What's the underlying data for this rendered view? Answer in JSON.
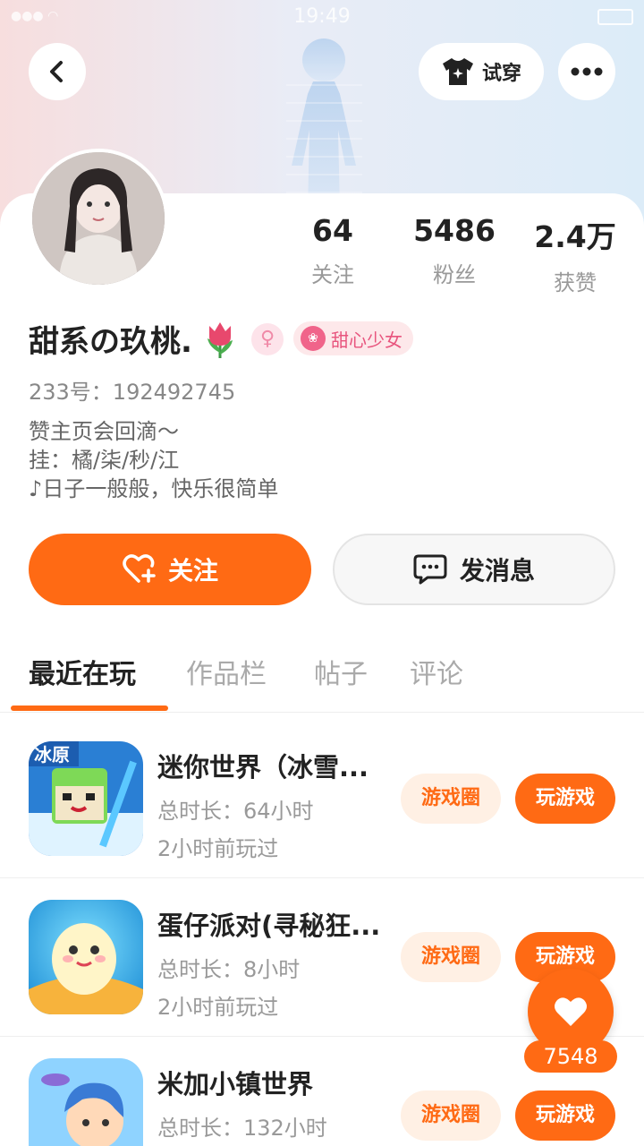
{
  "status_bar": {
    "time": "19:49"
  },
  "header": {
    "try_on_label": "试穿",
    "try_on_icon": "tshirt-icon",
    "more_icon": "more-dots-icon",
    "back_icon": "chevron-left-icon"
  },
  "profile": {
    "name": "甜系の玖桃.",
    "gender_symbol": "♀",
    "badge_label": "甜心少女",
    "uid": "233号：192492745",
    "bio": [
      "赞主页会回滴～",
      "挂：橘/柒/秒/江",
      "♪日子一般般，快乐很简单"
    ]
  },
  "stats": [
    {
      "value": "64",
      "label": "关注"
    },
    {
      "value": "5486",
      "label": "粉丝"
    },
    {
      "value": "2.4万",
      "label": "获赞"
    }
  ],
  "actions": {
    "follow_label": "关注",
    "message_label": "发消息"
  },
  "tabs": [
    {
      "label": "最近在玩",
      "active": true
    },
    {
      "label": "作品栏",
      "active": false
    },
    {
      "label": "帖子",
      "active": false
    },
    {
      "label": "评论",
      "active": false
    }
  ],
  "games": [
    {
      "name": "迷你世界（冰雪...",
      "total_time": "总时长：64小时",
      "last_played": "2小时前玩过",
      "circle_label": "游戏圈",
      "play_label": "玩游戏",
      "icon_text": "冰原"
    },
    {
      "name": "蛋仔派对(寻秘狂...",
      "total_time": "总时长：8小时",
      "last_played": "2小时前玩过",
      "circle_label": "游戏圈",
      "play_label": "玩游戏"
    },
    {
      "name": "米加小镇世界",
      "total_time": "总时长：132小时",
      "last_played": "",
      "circle_label": "游戏圈",
      "play_label": "玩游戏"
    }
  ],
  "like": {
    "count": "7548"
  },
  "colors": {
    "accent": "#ff6a14",
    "accent_light": "#fff0e4",
    "badge_pink": "#e8557e"
  }
}
